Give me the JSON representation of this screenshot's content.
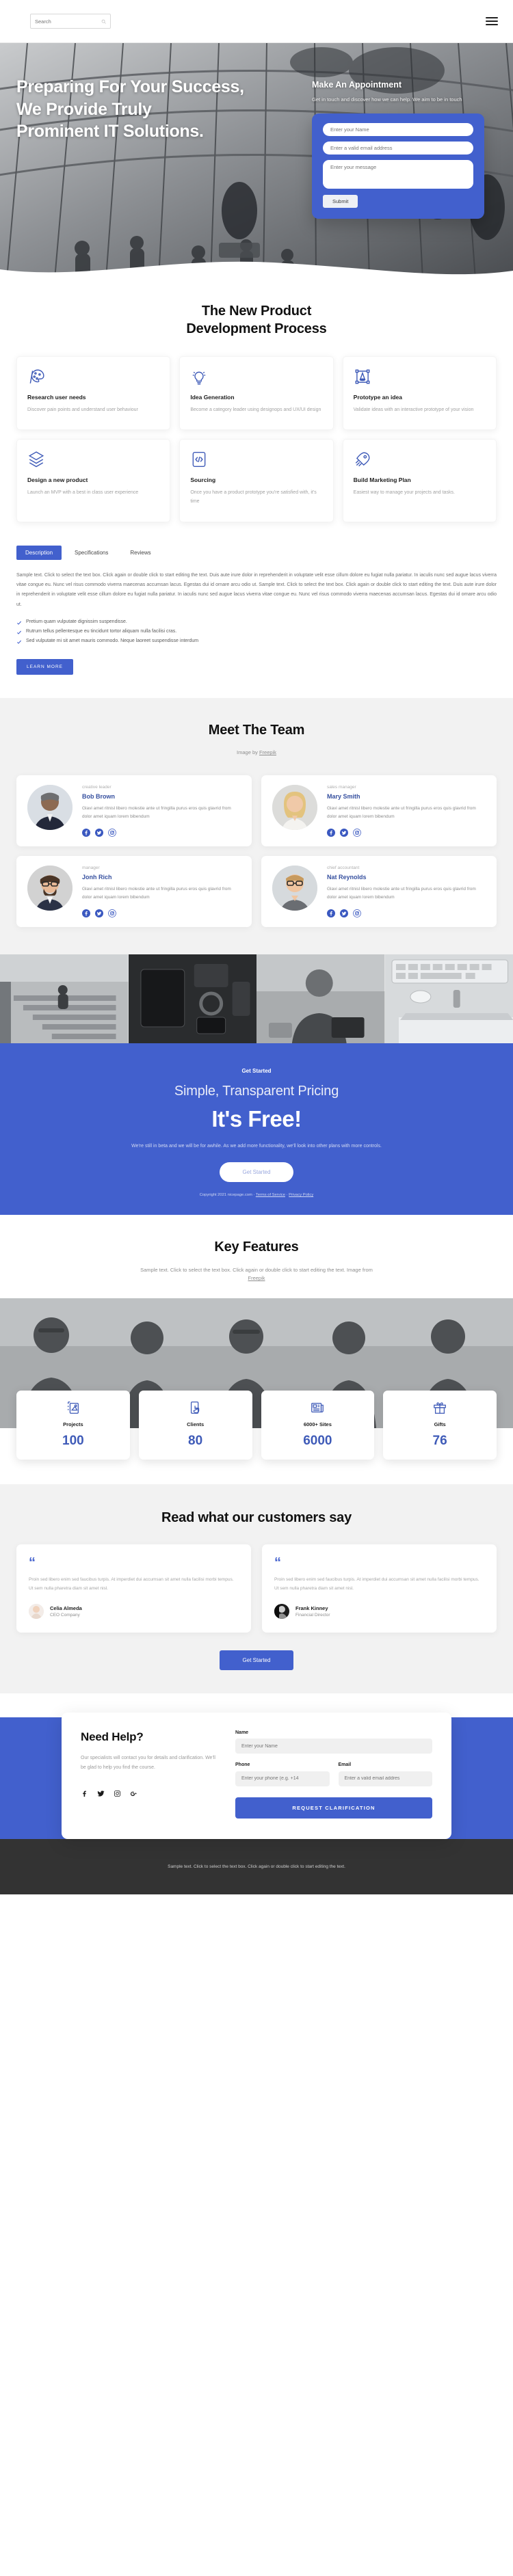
{
  "header": {
    "search_placeholder": "Search"
  },
  "hero": {
    "title_lines": [
      "Preparing For Your Success,",
      "We Provide Truly",
      "Prominent IT Solutions."
    ],
    "appointment_title": "Make An Appointment",
    "appointment_desc": "Get in touch and discover how we can help. We aim to be in touch",
    "name_placeholder": "Enter your Name",
    "email_placeholder": "Enter a valid email address",
    "message_placeholder": "Enter your message",
    "submit_label": "Submit"
  },
  "process": {
    "title_line1": "The New Product",
    "title_line2": "Development Process",
    "cards": [
      {
        "icon": "palette-icon",
        "title": "Research user needs",
        "desc": "Discover pain points and understand user behaviour"
      },
      {
        "icon": "lightbulb-icon",
        "title": "Idea Generation",
        "desc": "Become a category leader using designops and UX/UI design"
      },
      {
        "icon": "prototype-icon",
        "title": "Prototype an idea",
        "desc": "Validate ideas with an interactive prototype of your vision"
      },
      {
        "icon": "layers-icon",
        "title": "Design a new product",
        "desc": "Launch an MVP with a best in class user experience"
      },
      {
        "icon": "code-icon",
        "title": "Sourcing",
        "desc": "Once you have a product prototype you're satisfied with, it's time"
      },
      {
        "icon": "rocket-icon",
        "title": "Build Marketing Plan",
        "desc": "Easiest way to manage your projects and tasks."
      }
    ]
  },
  "tabs": {
    "items": [
      {
        "label": "Description",
        "active": true
      },
      {
        "label": "Specifications",
        "active": false
      },
      {
        "label": "Reviews",
        "active": false
      }
    ],
    "body": "Sample text. Click to select the text box. Click again or double click to start editing the text. Duis aute irure dolor in reprehenderit in voluptate velit esse cillum dolore eu fugiat nulla pariatur. In iaculis nunc sed augue lacus viverra vitae congue eu. Nunc vel risus commodo viverra maecenas accumsan lacus. Egestas dui id ornare arcu odio ut. Sample text. Click to select the text box. Click again or double click to start editing the text. Duis aute irure dolor in reprehenderit in voluptate velit esse cillum dolore eu fugiat nulla pariatur. In iaculis nunc sed augue lacus viverra vitae congue eu. Nunc vel risus commodo viverra maecenas accumsan lacus. Egestas dui id ornare arcu odio ut.",
    "checks": [
      "Pretium quam vulputate dignissim suspendisse.",
      "Rutrum tellus pellentesque eu tincidunt tortor aliquam nulla facilisi cras.",
      "Sed vulputate mi sit amet mauris commodo. Neque laoreet suspendisse interdum"
    ],
    "learn_more_label": "LEARN MORE"
  },
  "team": {
    "title": "Meet The Team",
    "credit_prefix": "Image by ",
    "credit_link": "Freepik",
    "members": [
      {
        "photo": "bob",
        "role": "creative leader",
        "name": "Bob Brown",
        "bio": "Glavi amet ritnisl libero molestie ante ut fringilla purus eros quis glavrid from dolor amet iquam lorem bibendum"
      },
      {
        "photo": "mary",
        "role": "sales manager",
        "name": "Mary Smith",
        "bio": "Glavi amet ritnisl libero molestie ante ut fringilla purus eros quis glavrid from dolor amet iquam lorem bibendum"
      },
      {
        "photo": "jonh",
        "role": "manager",
        "name": "Jonh Rich",
        "bio": "Glavi amet ritnisl libero molestie ante ut fringilla purus eros quis glavrid from dolor amet iquam lorem bibendum"
      },
      {
        "photo": "nat",
        "role": "chief accountant",
        "name": "Nat Reynolds",
        "bio": "Glavi amet ritnisl libero molestie ante ut fringilla purus eros quis glavrid from dolor amet iquam lorem bibendum"
      }
    ]
  },
  "pricing": {
    "eyebrow": "Get Started",
    "title": "Simple, Transparent Pricing",
    "big": "It's Free!",
    "desc": "We're still in beta and we will be for awhile. As we add more functionality, we'll look into other plans with more controls.",
    "button_label": "Get Started",
    "copyright": "Copyright 2021 nicepage.com",
    "terms": "Terms of Service",
    "privacy": "Privacy Policy"
  },
  "key_features": {
    "title": "Key Features",
    "subtitle": "Sample text. Click to select the text box. Click again or double click to start editing the text. Image from",
    "credit_link": "Freepik",
    "stats": [
      {
        "icon": "design-icon",
        "label": "Projects",
        "value": "100"
      },
      {
        "icon": "click-icon",
        "label": "Clients",
        "value": "80"
      },
      {
        "icon": "sites-icon",
        "label": "6000+ Sites",
        "value": "6000"
      },
      {
        "icon": "gift-icon",
        "label": "Gifts",
        "value": "76"
      }
    ]
  },
  "testimonials": {
    "title": "Read what our customers say",
    "items": [
      {
        "avatar": "celia",
        "text": "Proin sed libero enim sed faucibus turpis. At imperdiet dui accumsan sit amet nulla facilisi morbi tempus. Ut sem nulla pharetra diam sit amet nisl.",
        "name": "Celia Almeda",
        "role": "CEO Company"
      },
      {
        "avatar": "frank",
        "text": "Proin sed libero enim sed faucibus turpis. At imperdiet dui accumsan sit amet nulla facilisi morbi tempus. Ut sem nulla pharetra diam sit amet nisl.",
        "name": "Frank Kinney",
        "role": "Financial Director"
      }
    ],
    "button_label": "Get Started"
  },
  "help": {
    "title": "Need Help?",
    "desc": "Our specialists will contact you for details and clarification. We'll be glad to help you find the course.",
    "name_label": "Name",
    "name_placeholder": "Enter your Name",
    "phone_label": "Phone",
    "phone_placeholder": "Enter your phone (e.g. +14",
    "email_label": "Email",
    "email_placeholder": "Enter a valid email addres",
    "submit_label": "REQUEST CLARIFICATION"
  },
  "footer": {
    "text": "Sample text. Click to select the text box. Click again or double click to start editing the text."
  },
  "colors": {
    "brand": "#4260cd",
    "icon_blue": "#3f5bb8",
    "name_blue": "#36509f",
    "footer_bg": "#333333"
  }
}
